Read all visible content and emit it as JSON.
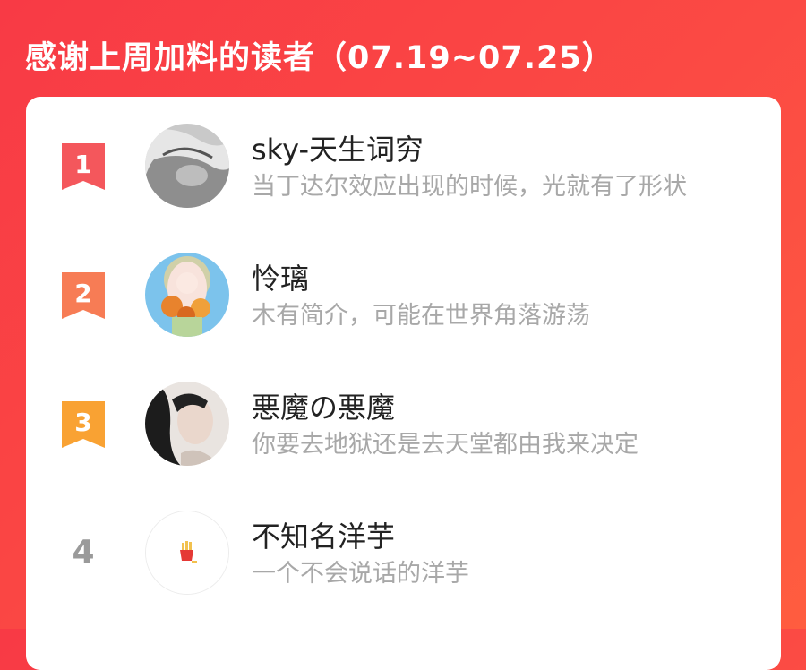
{
  "header": {
    "title": "感谢上周加料的读者（07.19~07.25）"
  },
  "colors": {
    "background": "#f83a45",
    "rank1": "#f4575c",
    "rank2": "#f77c55",
    "rank3": "#f9a233",
    "rank_plain": "#9a9a9a"
  },
  "readers": [
    {
      "rank": "1",
      "name": "sky-天生词穷",
      "bio": "当丁达尔效应出现的时候，光就有了形状",
      "avatar_icon": "sleeping-boy-avatar"
    },
    {
      "rank": "2",
      "name": "怜璃",
      "bio": "木有简介，可能在世界角落游荡",
      "avatar_icon": "anime-girl-flowers-avatar"
    },
    {
      "rank": "3",
      "name": "悪魔の悪魔",
      "bio": "你要去地狱还是去天堂都由我来决定",
      "avatar_icon": "girl-portrait-avatar"
    },
    {
      "rank": "4",
      "name": "不知名洋芋",
      "bio": "一个不会说话的洋芋",
      "avatar_icon": "french-fries-avatar"
    }
  ]
}
